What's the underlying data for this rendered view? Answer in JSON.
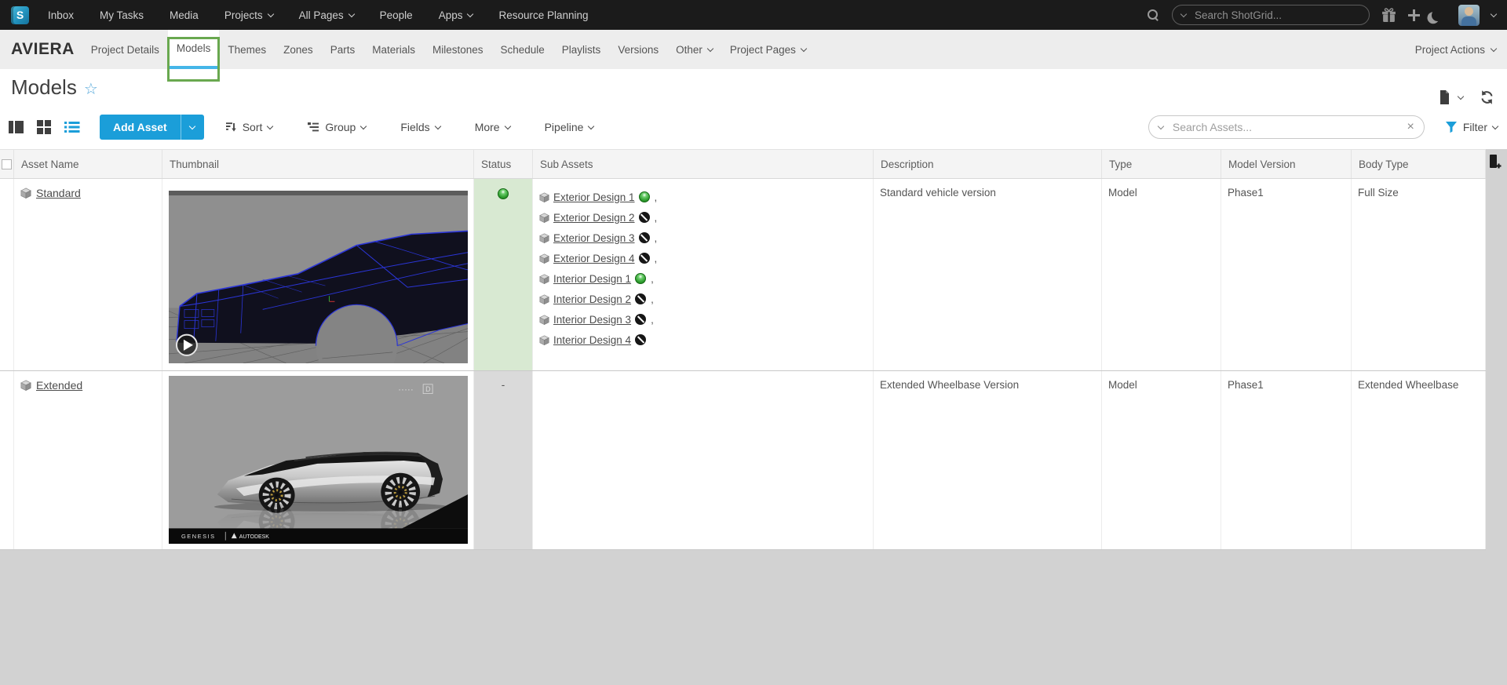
{
  "topbar": {
    "logo_letter": "S",
    "items": [
      {
        "label": "Inbox",
        "dropdown": false
      },
      {
        "label": "My Tasks",
        "dropdown": false
      },
      {
        "label": "Media",
        "dropdown": false
      },
      {
        "label": "Projects",
        "dropdown": true
      },
      {
        "label": "All Pages",
        "dropdown": true
      },
      {
        "label": "People",
        "dropdown": false
      },
      {
        "label": "Apps",
        "dropdown": true
      },
      {
        "label": "Resource Planning",
        "dropdown": false
      }
    ],
    "search_placeholder": "Search ShotGrid..."
  },
  "project_nav": {
    "project_name": "AVIERA",
    "tabs": [
      {
        "label": "Project Details"
      },
      {
        "label": "Models",
        "active": true,
        "highlighted": true
      },
      {
        "label": "Themes"
      },
      {
        "label": "Zones"
      },
      {
        "label": "Parts"
      },
      {
        "label": "Materials"
      },
      {
        "label": "Milestones"
      },
      {
        "label": "Schedule"
      },
      {
        "label": "Playlists"
      },
      {
        "label": "Versions"
      },
      {
        "label": "Other",
        "dropdown": true
      },
      {
        "label": "Project Pages",
        "dropdown": true
      }
    ],
    "project_actions_label": "Project Actions",
    "highlight_box_color": "#69a84f",
    "active_tab_underline": "#45b6e8"
  },
  "page": {
    "title": "Models",
    "favorite_icon": "☆"
  },
  "toolbar": {
    "add_asset_label": "Add Asset",
    "sort_label": "Sort",
    "group_label": "Group",
    "fields_label": "Fields",
    "more_label": "More",
    "pipeline_label": "Pipeline",
    "search_placeholder": "Search Assets...",
    "clear_icon": "×",
    "filter_label": "Filter",
    "accent_color": "#1b9ed9",
    "active_view": "list"
  },
  "table": {
    "columns": [
      "Asset Name",
      "Thumbnail",
      "Status",
      "Sub Assets",
      "Description",
      "Type",
      "Model Version",
      "Body Type"
    ],
    "status_colors": {
      "active_bg": "#d8e9d2",
      "blank_bg": "#dadada",
      "active_green": "#2f9e2f",
      "omit_black": "#161616"
    },
    "rows": [
      {
        "name": "Standard",
        "status": "active",
        "sub_assets": [
          {
            "label": "Exterior Design 1",
            "status": "active",
            "sep": ","
          },
          {
            "label": "Exterior Design 2",
            "status": "omit",
            "sep": ","
          },
          {
            "label": "Exterior Design 3",
            "status": "omit",
            "sep": ","
          },
          {
            "label": "Exterior Design 4",
            "status": "omit",
            "sep": ","
          },
          {
            "label": "Interior Design 1",
            "status": "active",
            "sep": ","
          },
          {
            "label": "Interior Design 2",
            "status": "omit",
            "sep": ","
          },
          {
            "label": "Interior Design 3",
            "status": "omit",
            "sep": ","
          },
          {
            "label": "Interior Design 4",
            "status": "omit",
            "sep": ""
          }
        ],
        "description": "Standard vehicle version",
        "type": "Model",
        "model_version": "Phase1",
        "body_type": "Full Size"
      },
      {
        "name": "Extended",
        "status": "blank",
        "status_label": "-",
        "sub_assets": [],
        "description": "Extended Wheelbase Version",
        "type": "Model",
        "model_version": "Phase1",
        "body_type": "Extended Wheelbase",
        "watermarks": {
          "brand_left": "GENESIS",
          "brand_right": "AUTODESK",
          "corner": "D"
        }
      }
    ]
  }
}
